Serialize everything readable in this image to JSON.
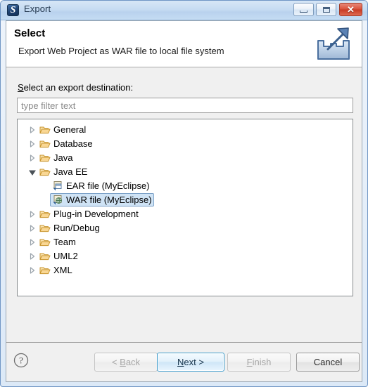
{
  "window": {
    "title": "Export",
    "icon": "myeclipse-logo-icon",
    "glyph": "S",
    "minimize_label": "Minimize",
    "maximize_label": "Maximize",
    "close_label": "✕"
  },
  "header": {
    "title": "Select",
    "subtitle": "Export Web Project as WAR file to local file system",
    "icon": "export-arrow-icon"
  },
  "body": {
    "destination_label_prefix": "S",
    "destination_label_rest": "elect an export destination:",
    "filter": {
      "placeholder": "type filter text",
      "value": ""
    },
    "tree": [
      {
        "label": "General",
        "level": 1,
        "state": "collapsed",
        "icon": "folder-icon",
        "selected": false
      },
      {
        "label": "Database",
        "level": 1,
        "state": "collapsed",
        "icon": "folder-icon",
        "selected": false
      },
      {
        "label": "Java",
        "level": 1,
        "state": "collapsed",
        "icon": "folder-icon",
        "selected": false
      },
      {
        "label": "Java EE",
        "level": 1,
        "state": "expanded",
        "icon": "folder-icon",
        "selected": false
      },
      {
        "label": "EAR file (MyEclipse)",
        "level": 2,
        "state": "leaf",
        "icon": "ear-file-icon",
        "selected": false
      },
      {
        "label": "WAR file (MyEclipse)",
        "level": 2,
        "state": "leaf",
        "icon": "war-file-icon",
        "selected": true
      },
      {
        "label": "Plug-in Development",
        "level": 1,
        "state": "collapsed",
        "icon": "folder-icon",
        "selected": false
      },
      {
        "label": "Run/Debug",
        "level": 1,
        "state": "collapsed",
        "icon": "folder-icon",
        "selected": false
      },
      {
        "label": "Team",
        "level": 1,
        "state": "collapsed",
        "icon": "folder-icon",
        "selected": false
      },
      {
        "label": "UML2",
        "level": 1,
        "state": "collapsed",
        "icon": "folder-icon",
        "selected": false
      },
      {
        "label": "XML",
        "level": 1,
        "state": "collapsed",
        "icon": "folder-icon",
        "selected": false
      }
    ]
  },
  "footer": {
    "help_icon": "help-question-icon",
    "buttons": {
      "back": {
        "prefix": "< ",
        "mnemonic": "B",
        "rest": "ack",
        "state": "disabled"
      },
      "next": {
        "prefix": "",
        "mnemonic": "N",
        "rest": "ext >",
        "state": "default"
      },
      "finish": {
        "prefix": "",
        "mnemonic": "F",
        "rest": "inish",
        "state": "disabled"
      },
      "cancel": {
        "prefix": "",
        "mnemonic": "",
        "rest": "Cancel",
        "state": "enabled"
      }
    }
  },
  "colors": {
    "titlebar_blue": "#c7dcf2",
    "window_border": "#6f95c4",
    "selection_fill": "#cfe3f5",
    "selection_border": "#7da2c8",
    "default_button_border": "#3d9ccc",
    "close_red": "#c73b24",
    "folder_yellow": "#f6d99a",
    "folder_outline": "#c8952f"
  }
}
